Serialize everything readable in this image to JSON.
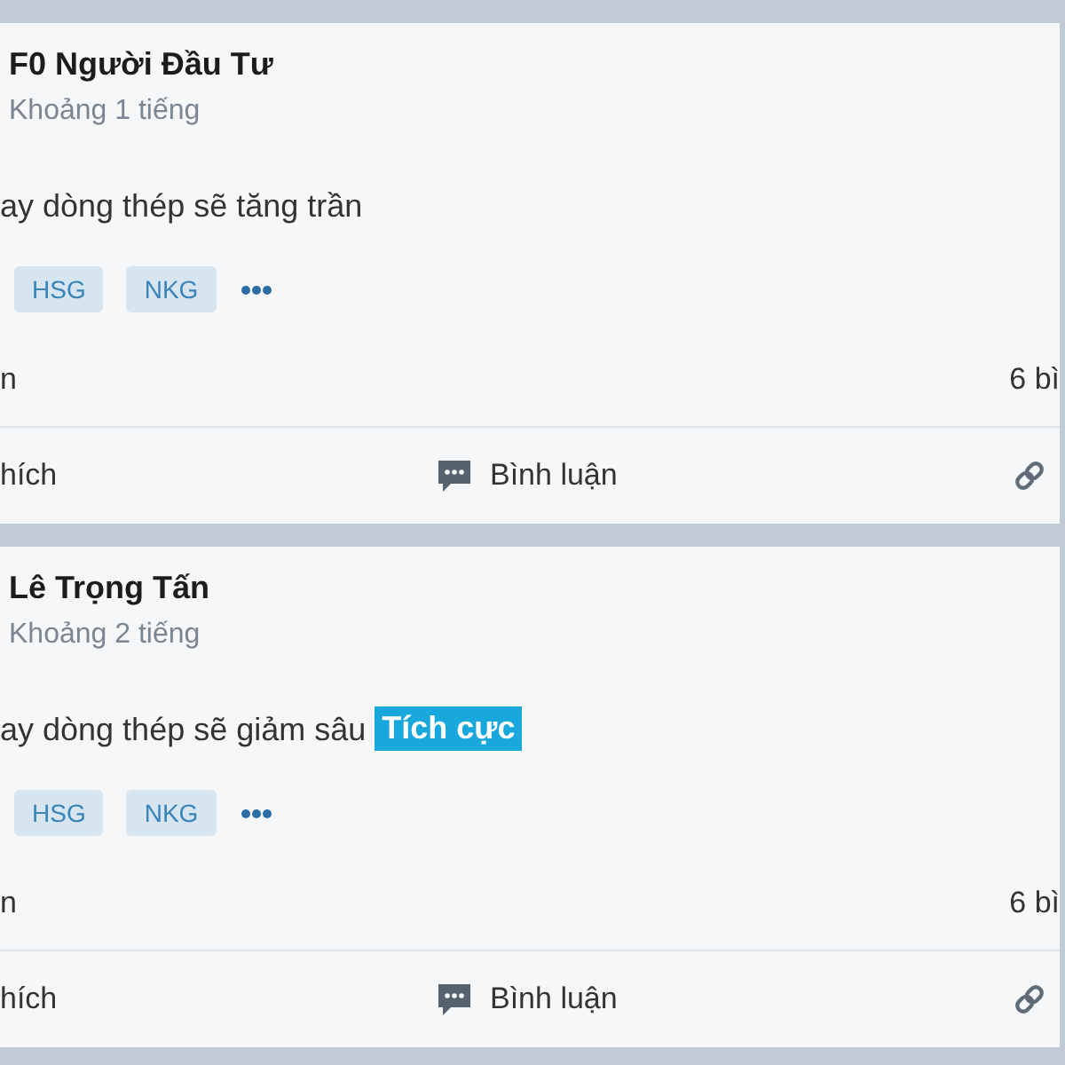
{
  "posts": [
    {
      "author": "F0 Người Đầu Tư",
      "time": "Khoảng 1 tiếng",
      "text": "ay dòng thép sẽ tăng trần",
      "tags": [
        "HSG",
        "NKG"
      ],
      "stats": [
        "n",
        "6 bì"
      ],
      "actions": [
        {
          "kind": "like",
          "label": "hích"
        },
        {
          "kind": "comment",
          "label": "Bình luận"
        },
        {
          "kind": "link"
        }
      ]
    },
    {
      "author": "Lê Trọng Tấn",
      "time": "Khoảng 2 tiếng",
      "text": "ay dòng thép sẽ giảm sâu",
      "badge": "Tích cực",
      "tags": [
        "HSG",
        "NKG"
      ],
      "stats": [
        "n",
        "6 bì"
      ],
      "actions": [
        {
          "kind": "like",
          "label": "hích"
        },
        {
          "kind": "comment",
          "label": "Bình luận"
        },
        {
          "kind": "link"
        }
      ]
    }
  ]
}
